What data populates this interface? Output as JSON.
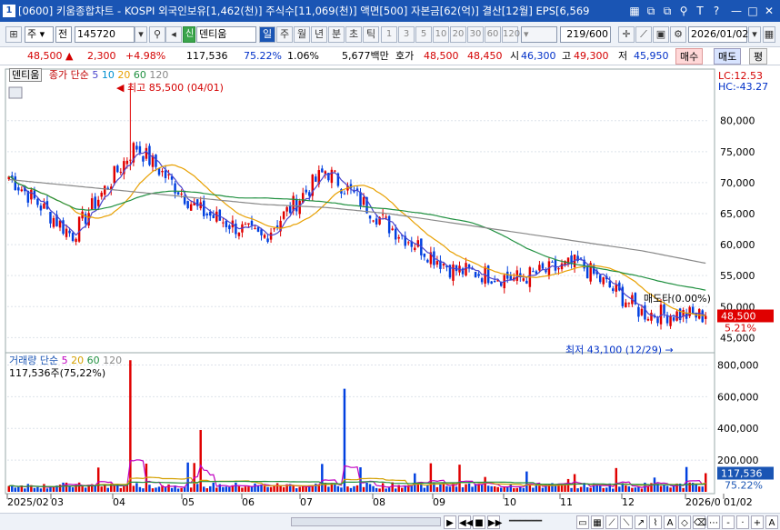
{
  "window": {
    "number": "1",
    "title": "[0600] 키움종합차트 - KOSPI 외국인보유[1,462(천)] 주식수[11,069(천)] 액면[500] 자본금[62(억)] 결산[12월] EPS[6,569"
  },
  "toolbar": {
    "mode": "주",
    "market": "전",
    "code": "145720",
    "badge": "신",
    "name": "덴티움",
    "periods": [
      "일",
      "주",
      "월",
      "년",
      "분",
      "초",
      "틱"
    ],
    "active_period": "일",
    "intervals": [
      "1",
      "3",
      "5",
      "10",
      "20",
      "30",
      "60",
      "120"
    ],
    "count": "219/600",
    "date": "2026/01/02"
  },
  "quote": {
    "price": "48,500",
    "change": "2,300",
    "change_pct": "+4.98%",
    "volume": "117,536",
    "vol_ratio": "75.22%",
    "turnover": "1.06%",
    "amount": "5,677백만",
    "bid_label": "호가",
    "bid1": "48,500",
    "bid2": "48,450",
    "open_label": "시",
    "open": "46,300",
    "high_label": "고",
    "high": "49,300",
    "low_label": "저",
    "low": "45,950",
    "buy": "매수",
    "sell": "매도",
    "avg": "평"
  },
  "colors": {
    "up": "#e00000",
    "down": "#0040e0",
    "ma5": "#4a44cc",
    "ma20": "#e8a000",
    "ma60": "#209040",
    "ma120": "#888888",
    "vma5": "#c000c0",
    "vma20": "#d4a000"
  },
  "price_legend": {
    "name": "덴티움",
    "label": "종가 단순",
    "p1": "5",
    "p2": "10",
    "p3": "20",
    "p4": "60",
    "p5": "120"
  },
  "volume_legend": {
    "label": "거래량 단순",
    "p1": "5",
    "p2": "20",
    "p3": "60",
    "p4": "120",
    "current": "117,536주(75,22%)"
  },
  "price_axis": {
    "ticks": [
      "80,000",
      "75,000",
      "70,000",
      "65,000",
      "60,000",
      "55,000",
      "50,000",
      "45,000"
    ],
    "lc": "LC:12.53",
    "hc": "HC:-43.27",
    "current": "48,500",
    "pct": "5.21%"
  },
  "volume_axis": {
    "ticks": [
      "800,000",
      "600,000",
      "400,000",
      "200,000"
    ],
    "current": "117,536",
    "pct": "75.22%"
  },
  "x_axis": {
    "labels": [
      "2025/02",
      "03",
      "04",
      "05",
      "06",
      "07",
      "08",
      "09",
      "10",
      "11",
      "12",
      "2026/0",
      "01/02"
    ]
  },
  "annotations": {
    "high": "최고 85,500 (04/01)",
    "low": "최저 43,100 (12/29)",
    "signal": "매도타(0.00%)"
  },
  "chart_data": {
    "type": "line",
    "x": [
      "2025/02",
      "03",
      "04",
      "05",
      "06",
      "07",
      "08",
      "09",
      "10",
      "11",
      "12",
      "2026/01"
    ],
    "series": [
      {
        "name": "종가",
        "values": [
          71000,
          61500,
          76000,
          65500,
          61000,
          72000,
          63000,
          56000,
          54500,
          57000,
          49000,
          48500
        ]
      },
      {
        "name": "120",
        "values": [
          70500,
          69500,
          68500,
          67500,
          66500,
          66000,
          65000,
          63500,
          62000,
          60500,
          59000,
          57000
        ]
      }
    ],
    "ylim": [
      43000,
      87000
    ],
    "high": 85500,
    "low": 43100,
    "volume_ylim": [
      0,
      860000
    ]
  }
}
